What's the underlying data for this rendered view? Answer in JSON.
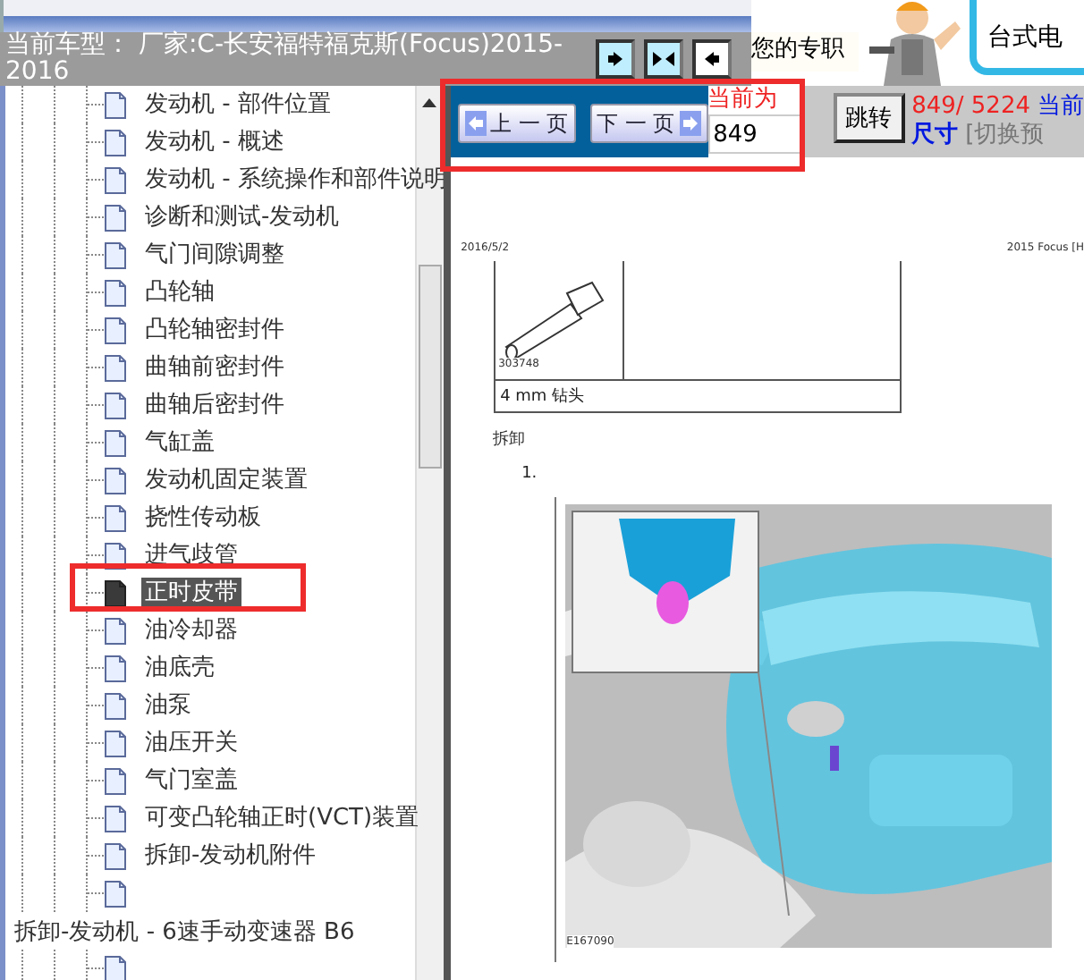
{
  "vehicle_bar": {
    "label": "当前车型：",
    "value": "厂家:C-长安福特福克斯(Focus)2015-2016"
  },
  "banner": {
    "text": "您的专职",
    "bubble": "台式电"
  },
  "tree": {
    "nodes": [
      {
        "children": [
          {
            "label": "发动机 - 部件位置",
            "selected": false
          },
          {
            "label": "发动机 - 概述",
            "selected": false
          },
          {
            "label": "发动机 - 系统操作和部件说明",
            "selected": false
          },
          {
            "label": "诊断和测试-发动机",
            "selected": false
          },
          {
            "label": "气门间隙调整",
            "selected": false
          },
          {
            "label": "凸轮轴",
            "selected": false
          },
          {
            "label": "凸轮轴密封件",
            "selected": false
          },
          {
            "label": "曲轴前密封件",
            "selected": false
          },
          {
            "label": "曲轴后密封件",
            "selected": false
          },
          {
            "label": "气缸盖",
            "selected": false
          },
          {
            "label": "发动机固定装置",
            "selected": false
          },
          {
            "label": "挠性传动板",
            "selected": false
          },
          {
            "label": "进气歧管",
            "selected": false
          },
          {
            "label": "正时皮带",
            "selected": true
          },
          {
            "label": "油冷却器",
            "selected": false
          },
          {
            "label": "油底壳",
            "selected": false
          },
          {
            "label": "油泵",
            "selected": false
          },
          {
            "label": "油压开关",
            "selected": false
          },
          {
            "label": "气门室盖",
            "selected": false
          },
          {
            "label": "可变凸轮轴正时(VCT)装置",
            "selected": false
          },
          {
            "label": "拆卸-发动机附件",
            "selected": false
          },
          {
            "selected": false
          }
        ]
      },
      {
        "label": "拆卸-发动机 - 6速手动变速器 B6",
        "children": [
          {
            "selected": false
          }
        ]
      }
    ]
  },
  "toolbar": {
    "prev": "上 一 页",
    "next": "下 一 页",
    "current_label": "当前为",
    "page_value": "849",
    "jump": "跳转",
    "page_count": "849/ 5224",
    "current_link": "当前",
    "size": "尺寸",
    "switch": "[切换预"
  },
  "document": {
    "date": "2016/5/2",
    "header_right": "2015 Focus [H",
    "tool_number": "303748",
    "tool_caption": "4 mm 钻头",
    "section": "拆卸",
    "step": "1.",
    "figure_id": "E167090"
  }
}
